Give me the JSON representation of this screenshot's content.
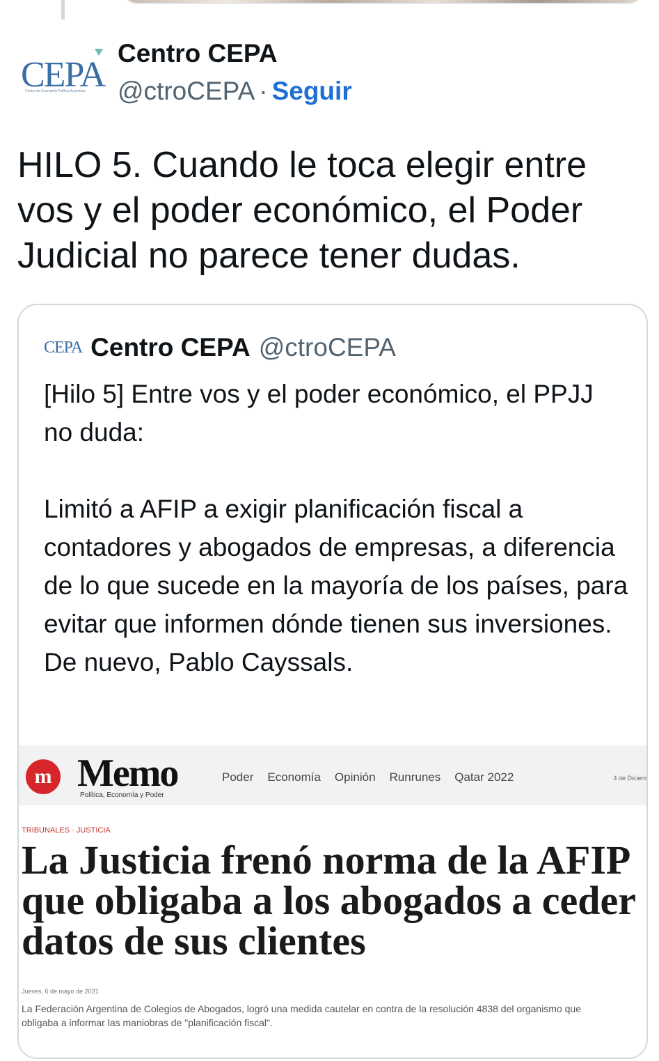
{
  "tweet": {
    "author_name": "Centro CEPA",
    "handle": "@ctroCEPA",
    "separator": "·",
    "follow_label": "Seguir",
    "avatar_logo": "CEPA",
    "avatar_subtitle": "Centro de Economía Política Argentina",
    "text": "HILO 5. Cuando le toca elegir entre vos y el poder económico, el Poder Judicial no parece tener dudas."
  },
  "quoted": {
    "avatar_logo": "CEPA",
    "author_name": "Centro CEPA",
    "handle": "@ctroCEPA",
    "paragraph1": "[Hilo 5] Entre vos y el poder económico, el PPJJ no duda:",
    "paragraph2": "Limitó a AFIP a exigir planificación fiscal a contadores y abogados de empresas, a diferencia de lo que sucede en la mayoría de los países, para evitar que informen dónde tienen sus inversiones. De nuevo, Pablo Cayssals.",
    "media": {
      "logo_mark": "m",
      "logo_text": "Memo",
      "logo_subtitle": "Política, Economía y Poder",
      "nav": [
        "Poder",
        "Economía",
        "Opinión",
        "Runrunes",
        "Qatar 2022"
      ],
      "date": "4 de Diciem",
      "section": "TRIBUNALES · JUSTICIA",
      "headline_line1": "La Justicia frenó norma de la AFIP",
      "headline_line2": "que obligaba a los abogados a ceder",
      "headline_line3": "datos de sus clientes",
      "pubdate": "Jueves, 6 de mayo de 2021",
      "lead_line1": "La Federación Argentina de Colegios de Abogados, logró una medida cautelar en contra de la resolución 4838 del organismo que",
      "lead_line2": "obligaba a informar las maniobras de \"planificación fiscal\"."
    }
  }
}
